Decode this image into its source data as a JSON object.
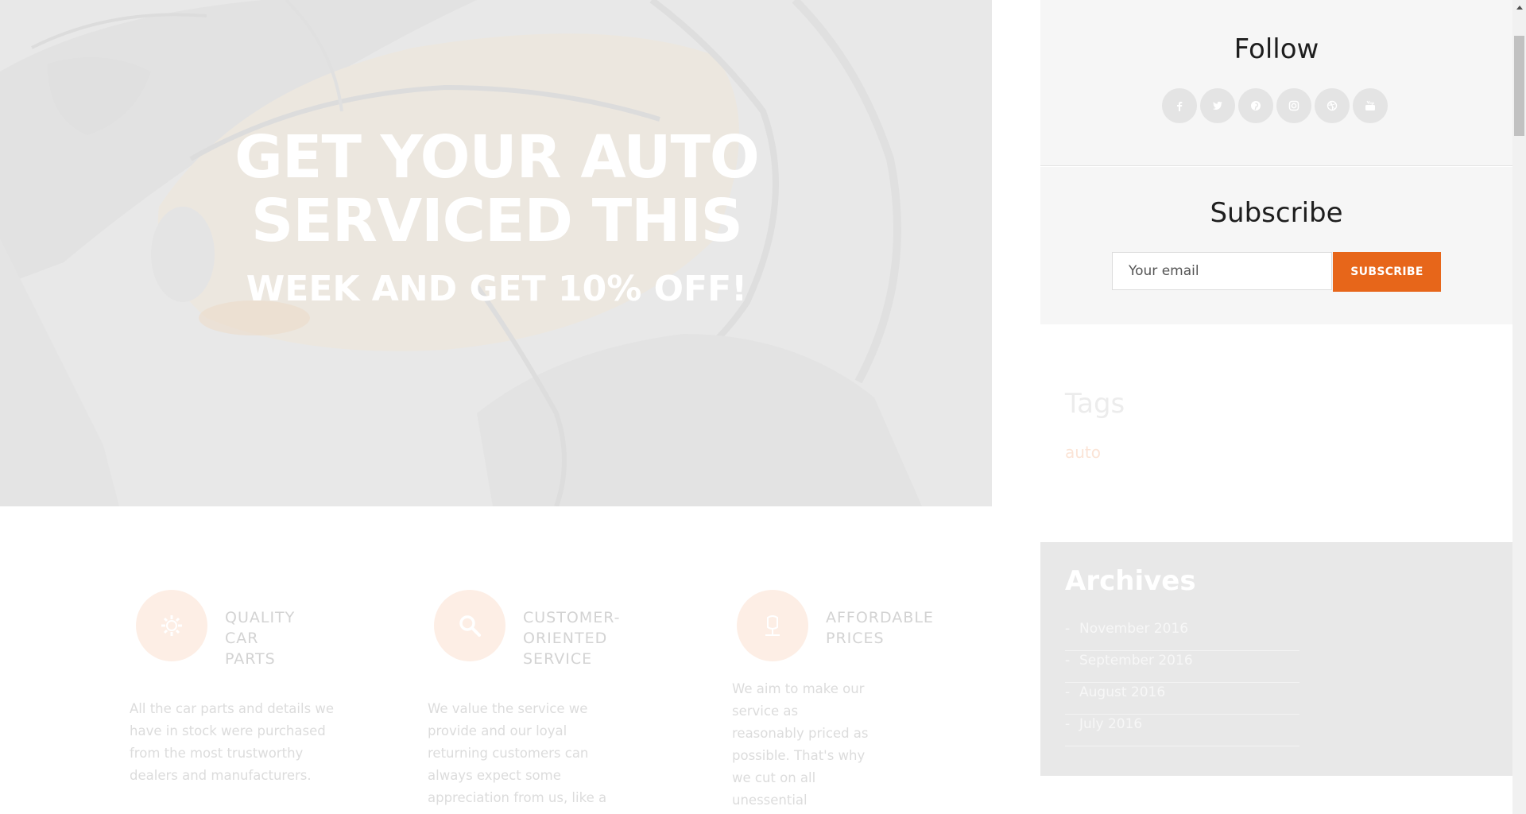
{
  "hero": {
    "title_line1": "GET YOUR AUTO",
    "title_line2": "SERVICED THIS",
    "subtitle": "WEEK AND GET 10% OFF!"
  },
  "features": [
    {
      "icon": "gear-icon",
      "title_lines": [
        "QUALITY",
        "CAR",
        "PARTS"
      ],
      "text_lines": [
        "All the car parts and details we",
        "have in stock were purchased",
        "from the most trustworthy",
        "dealers and manufacturers."
      ]
    },
    {
      "icon": "search-icon",
      "title_lines": [
        "CUSTOMER-",
        "ORIENTED",
        "SERVICE"
      ],
      "text_lines": [
        "We value the service we",
        "provide and our loyal",
        "returning customers can",
        "always expect some",
        "appreciation from us, like a"
      ]
    },
    {
      "icon": "price-tag-icon",
      "title_lines": [
        "AFFORDABLE",
        "PRICES"
      ],
      "text_lines": [
        "We aim to make our",
        "service as",
        "reasonably priced as",
        "possible. That's why",
        "we cut on all",
        "unessential"
      ]
    }
  ],
  "sidebar": {
    "follow_title": "Follow",
    "socials": [
      "facebook-icon",
      "twitter-icon",
      "pinterest-icon",
      "instagram-icon",
      "dribbble-icon",
      "youtube-icon"
    ],
    "subscribe_title": "Subscribe",
    "email_placeholder": "Your email",
    "subscribe_button": "SUBSCRIBE",
    "tags_title": "Tags",
    "tags": [
      "auto"
    ],
    "archives_title": "Archives",
    "archives": [
      "November 2016",
      "September 2016",
      "August 2016",
      "July 2016"
    ]
  },
  "colors": {
    "accent": "#e7661a",
    "hero_overlay": "#e9e9e9",
    "feature_circle": "#fdeee5"
  }
}
